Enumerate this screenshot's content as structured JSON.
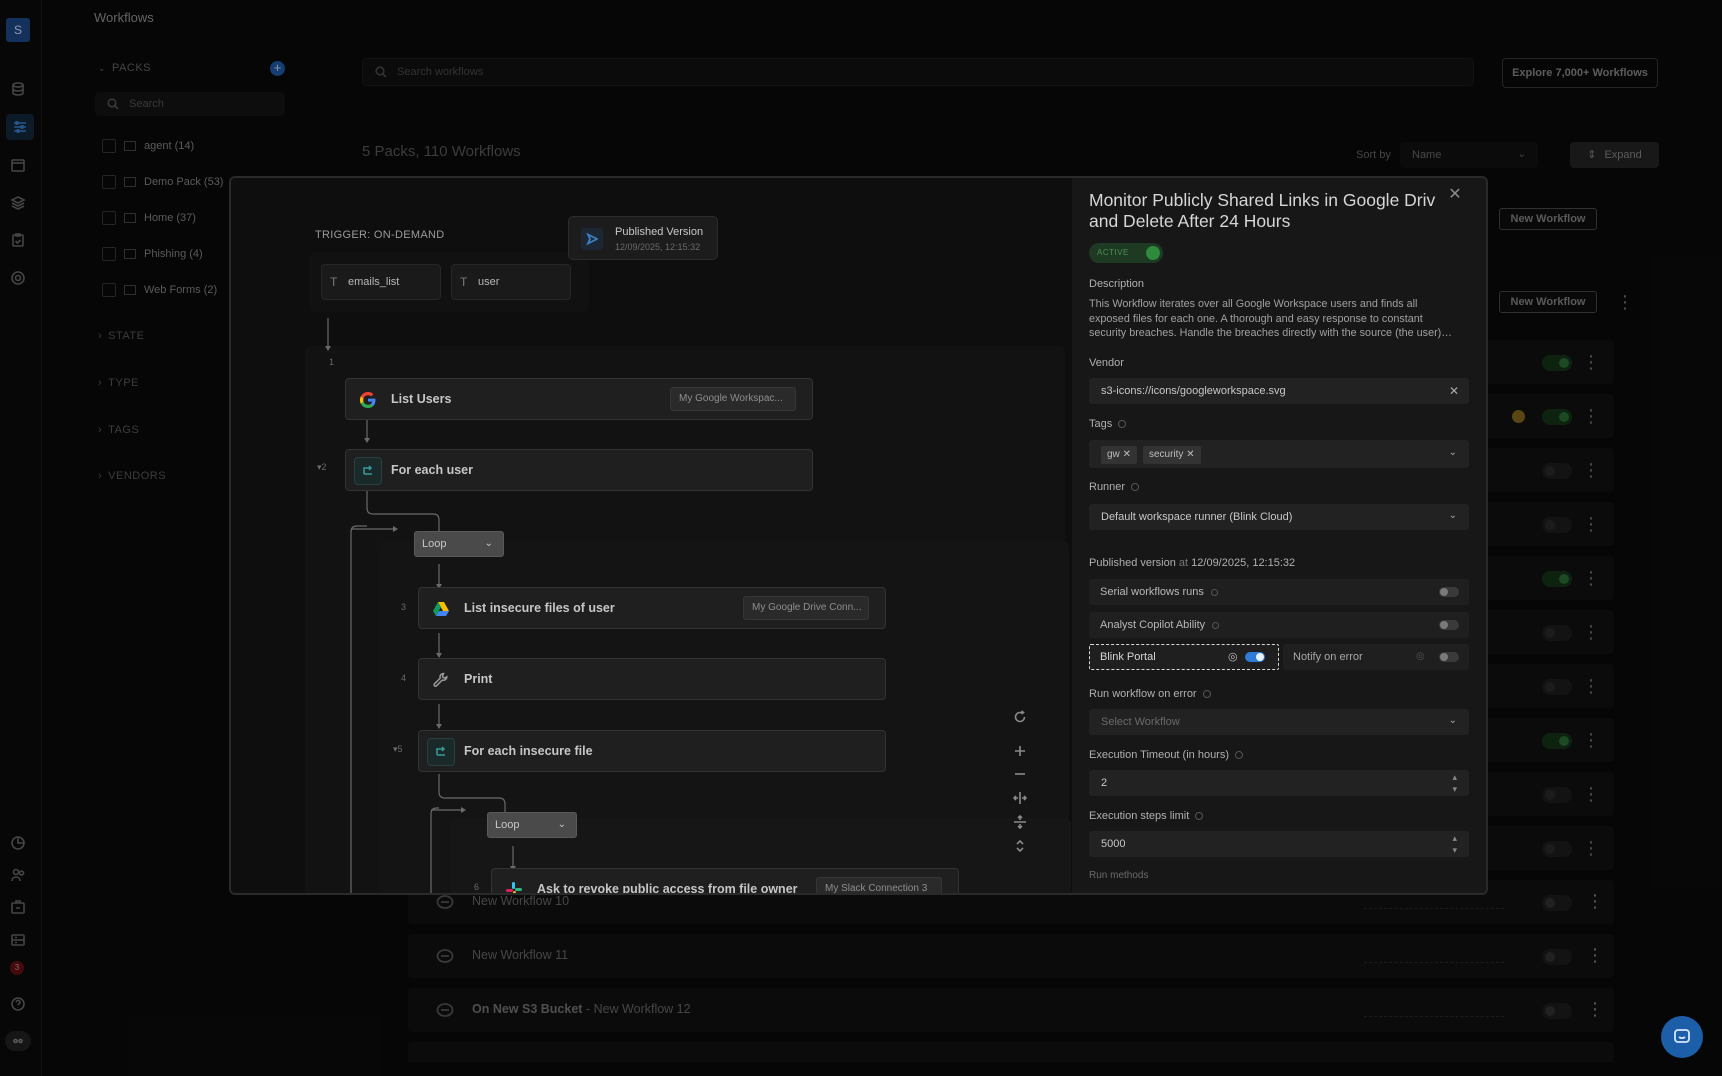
{
  "app": {
    "avatar_letter": "S",
    "page_title": "Workflows",
    "notification_count": "3"
  },
  "packs": {
    "header": "PACKS",
    "add_label": "+",
    "search_placeholder": "Search",
    "items": [
      {
        "label": "agent (14)"
      },
      {
        "label": "Demo Pack (53)"
      },
      {
        "label": "Home (37)"
      },
      {
        "label": "Phishing (4)"
      },
      {
        "label": "Web Forms (2)"
      }
    ],
    "sections": [
      "STATE",
      "TYPE",
      "TAGS",
      "VENDORS"
    ]
  },
  "main": {
    "search_placeholder": "Search workflows",
    "explore_label": "Explore 7,000+ Workflows",
    "count_label": "5 Packs, 110 Workflows",
    "sort_label": "Sort by",
    "sort_value": "Name",
    "expand_label": "Expand",
    "new_workflow_label": "New Workflow",
    "rows": [
      {
        "name": "New Workflow 10",
        "prefix": ""
      },
      {
        "name": "New Workflow 11",
        "prefix": ""
      },
      {
        "name": "New Workflow 12",
        "prefix": "On New S3 Bucket"
      }
    ]
  },
  "canvas": {
    "trigger_label": "TRIGGER: ON-DEMAND",
    "params": [
      "emails_list",
      "user"
    ],
    "param_type_glyph": "T",
    "published": {
      "title": "Published Version",
      "date": "12/09/2025, 12:15:32"
    },
    "steps": [
      {
        "num": "1",
        "title": "List Users",
        "conn": "My Google Workspac..."
      },
      {
        "num": "2",
        "title": "For each user",
        "conn": ""
      },
      {
        "num": "3",
        "title": "List insecure files of user",
        "conn": "My Google Drive Conn..."
      },
      {
        "num": "4",
        "title": "Print",
        "conn": ""
      },
      {
        "num": "5",
        "title": "For each insecure file",
        "conn": ""
      },
      {
        "num": "6",
        "title": "Ask to revoke public access from file owner",
        "conn": "My Slack Connection 3"
      }
    ],
    "loop_label": "Loop"
  },
  "panel": {
    "title_line1": "Monitor Publicly Shared Links in Google Driv",
    "title_line2": "and Delete After 24 Hours",
    "status": "ACTIVE",
    "description_label": "Description",
    "description": "This Workflow iterates over all Google Workspace users and finds all exposed files for each one. A thorough and easy response to constant security breaches. Handle the breaches directly with the source (the user)…",
    "vendor_label": "Vendor",
    "vendor_value": "s3-icons://icons/googleworkspace.svg",
    "tags_label": "Tags",
    "tags": [
      "gw",
      "security"
    ],
    "runner_label": "Runner",
    "runner_value": "Default workspace runner (Blink Cloud)",
    "published_label": "Published version",
    "published_at": "at",
    "published_date": "12/09/2025, 12:15:32",
    "serial_label": "Serial workflows runs",
    "copilot_label": "Analyst Copilot Ability",
    "blink_portal_label": "Blink Portal",
    "notify_label": "Notify on error",
    "run_on_error_label": "Run workflow on error",
    "run_on_error_placeholder": "Select Workflow",
    "timeout_label": "Execution Timeout (in hours)",
    "timeout_value": "2",
    "steps_limit_label": "Execution steps limit",
    "steps_limit_value": "5000",
    "run_methods_label": "Run methods"
  }
}
